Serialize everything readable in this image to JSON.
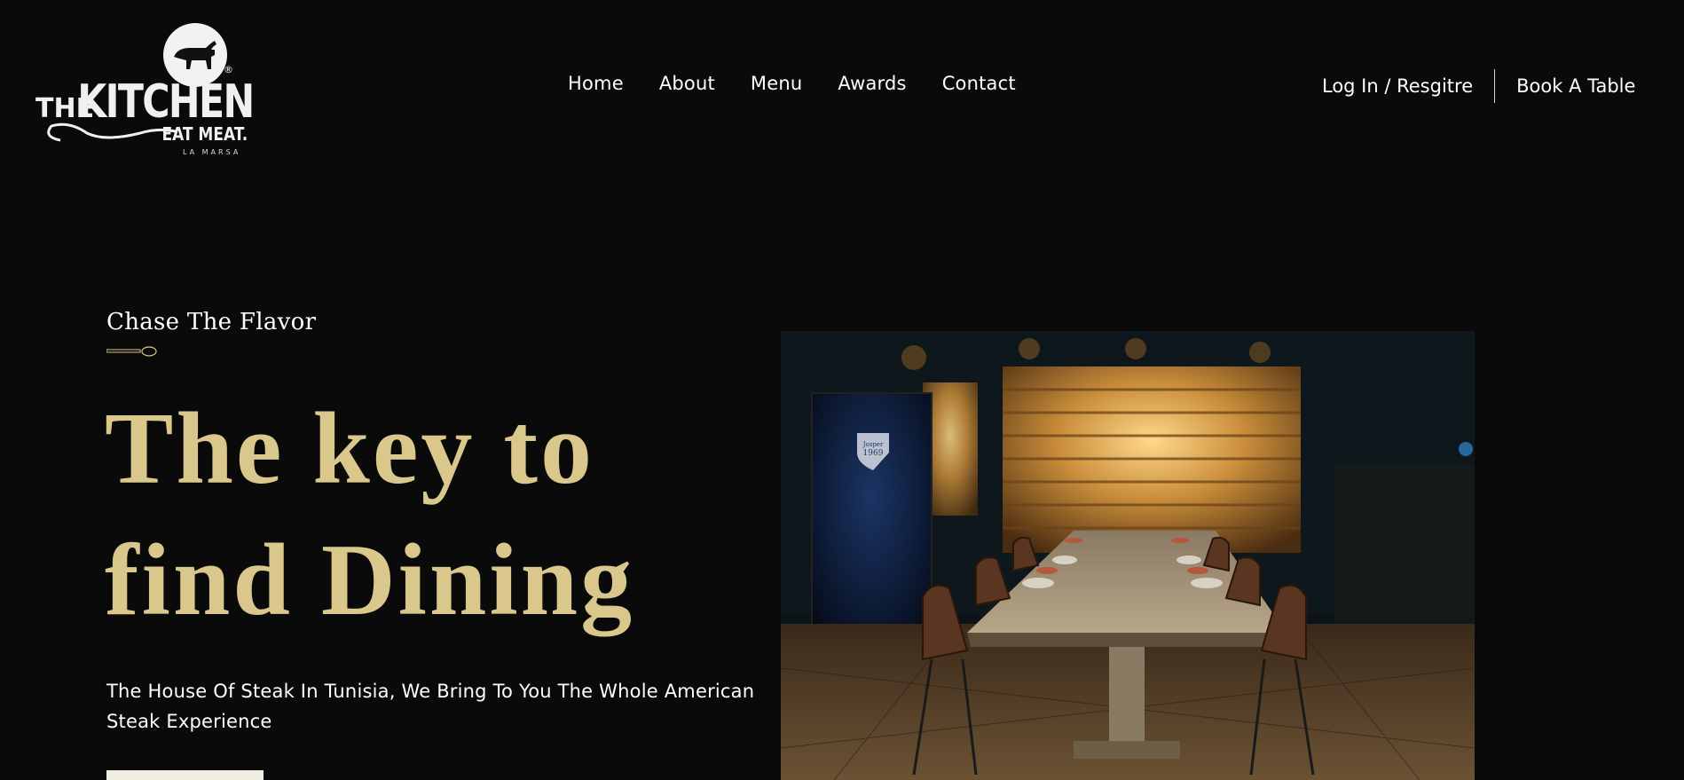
{
  "brand": {
    "logo_line1": "THE",
    "logo_line2": "KITCHEN",
    "logo_line3": "EAT MEAT.",
    "logo_line4": "LA MARSA",
    "logo_mark": "®"
  },
  "nav": {
    "items": [
      {
        "label": "Home"
      },
      {
        "label": "About"
      },
      {
        "label": "Menu"
      },
      {
        "label": "Awards"
      },
      {
        "label": "Contact"
      }
    ]
  },
  "header_actions": {
    "login_label": "Log In / Resgitre",
    "book_label": "Book A Table"
  },
  "hero": {
    "eyebrow": "Chase The Flavor",
    "headline": "The key to find Dining",
    "subtitle": "The House Of Steak In Tunisia, We Bring To You The Whole American Steak Experience",
    "image_sign_line1": "Josper",
    "image_sign_line2": "1969"
  },
  "colors": {
    "background": "#0a0a0a",
    "accent_gold": "#d9c78c",
    "text": "#ffffff"
  },
  "icons": {
    "logo_mark": "bull-icon",
    "eyebrow_ornament": "spoon-icon"
  }
}
